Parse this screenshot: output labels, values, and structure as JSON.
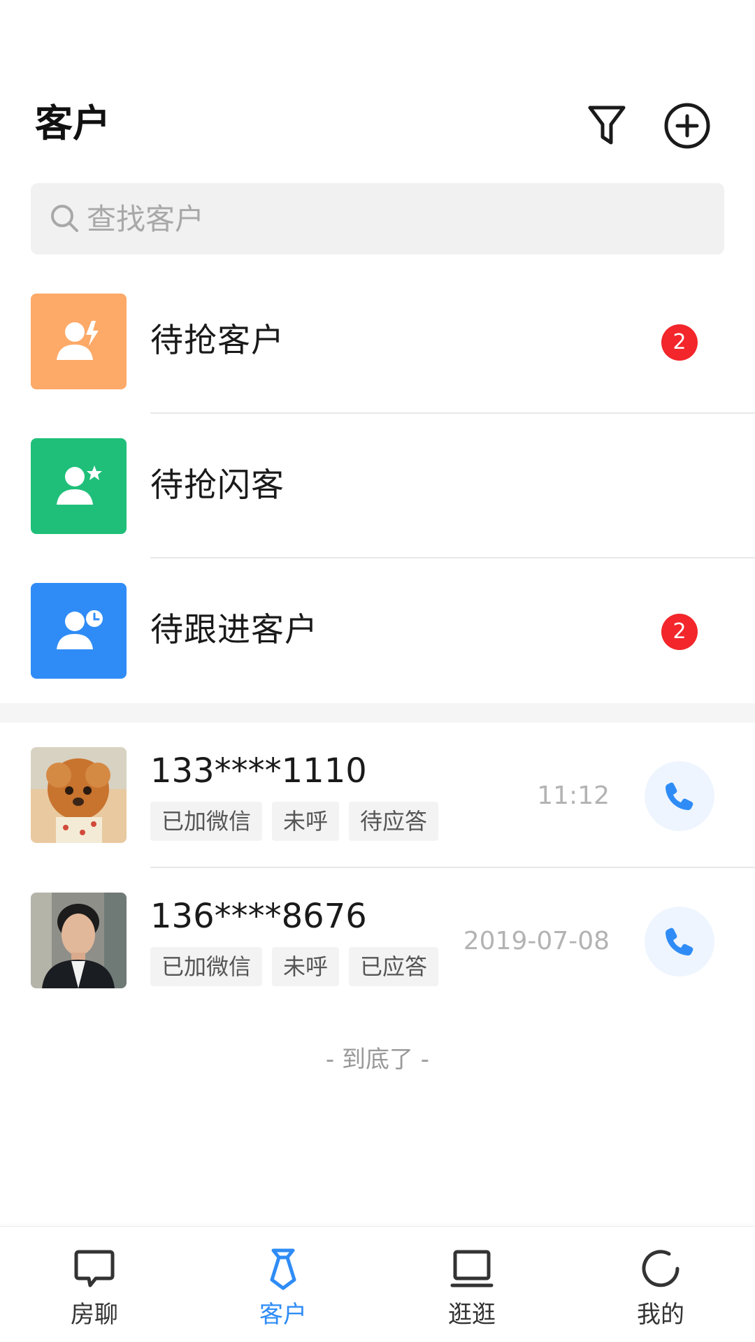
{
  "header": {
    "title": "客户"
  },
  "search": {
    "placeholder": "查找客户",
    "value": ""
  },
  "categories": [
    {
      "label": "待抢客户",
      "badge": "2",
      "icon": "user-lightning-icon",
      "color": "#fda968"
    },
    {
      "label": "待抢闪客",
      "badge": "",
      "icon": "user-star-icon",
      "color": "#1fbf7a"
    },
    {
      "label": "待跟进客户",
      "badge": "2",
      "icon": "user-clock-icon",
      "color": "#2f8cf6"
    }
  ],
  "customers": [
    {
      "phone": "133****1110",
      "tags": [
        "已加微信",
        "未呼",
        "待应答"
      ],
      "time": "11:12"
    },
    {
      "phone": "136****8676",
      "tags": [
        "已加微信",
        "未呼",
        "已应答"
      ],
      "time": "2019-07-08"
    }
  ],
  "end_text": "- 到底了 -",
  "tabbar": {
    "items": [
      {
        "label": "房聊",
        "icon": "chat-bubble-icon"
      },
      {
        "label": "客户",
        "icon": "tie-icon",
        "active": true
      },
      {
        "label": "逛逛",
        "icon": "laptop-icon"
      },
      {
        "label": "我的",
        "icon": "profile-circle-icon"
      }
    ]
  },
  "colors": {
    "accent": "#2f8cf6",
    "badge": "#f2262b",
    "orange": "#fda968",
    "green": "#1fbf7a",
    "blue": "#2f8cf6"
  }
}
